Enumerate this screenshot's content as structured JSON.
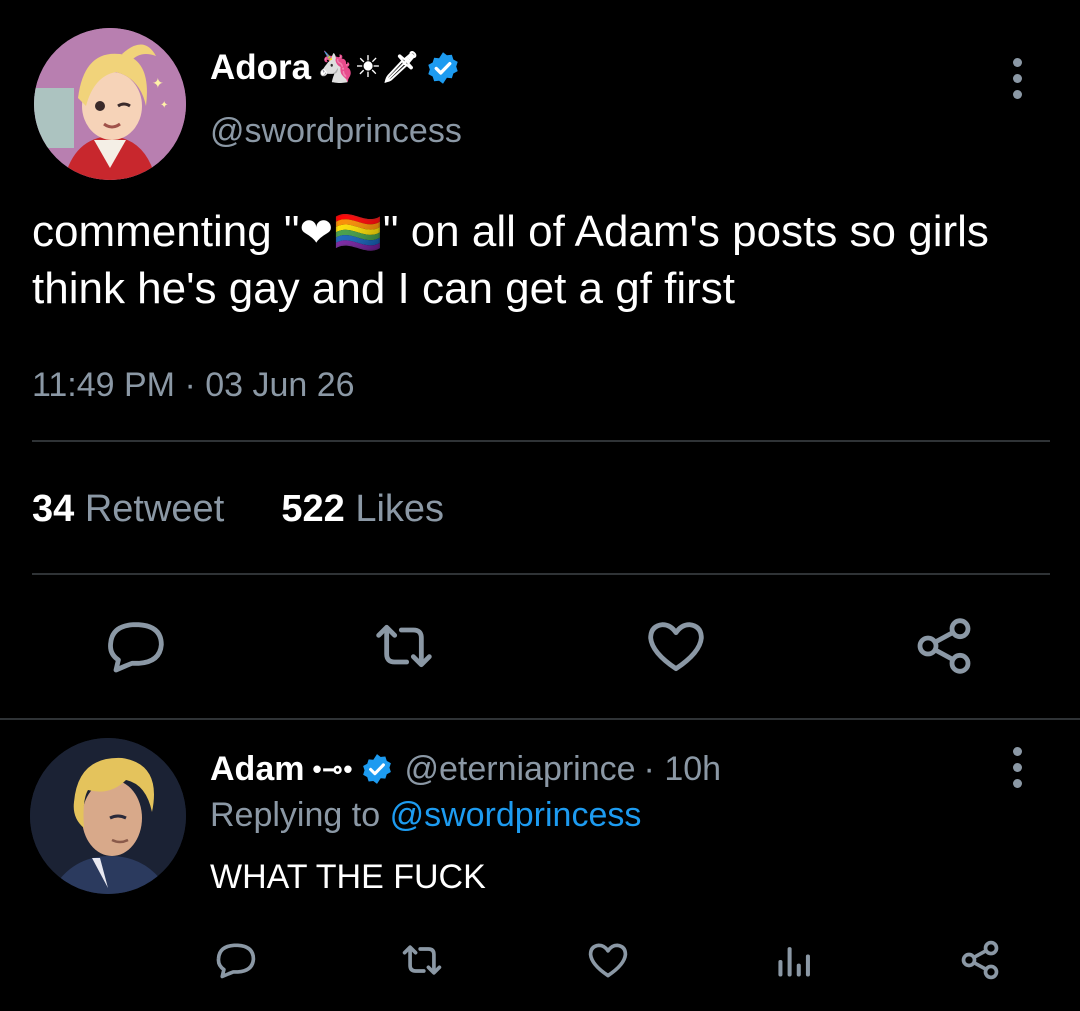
{
  "tweet": {
    "author": {
      "display_name": "Adora",
      "name_emojis": "🦄☀🗡",
      "handle": "@swordprincess",
      "verified": true
    },
    "text_before": "commenting \"",
    "text_emojis": "❤🏳️‍🌈",
    "text_after": "\" on all of Adam's posts so girls think he's gay and I can get a gf first",
    "timestamp": "11:49 PM · 03 Jun 26",
    "retweet_count": "34",
    "retweet_label": "Retweet",
    "like_count": "522",
    "like_label": "Likes"
  },
  "reply": {
    "author": {
      "display_name": "Adam",
      "name_deco": "•⊸•",
      "handle": "@eterniaprince",
      "verified": true
    },
    "time": "· 10h",
    "replying_prefix": "Replying to",
    "replying_to": "@swordprincess",
    "text": "WHAT THE FUCK"
  },
  "colors": {
    "background": "#000000",
    "text": "#ffffff",
    "muted": "#8b98a5",
    "accent": "#1d9bf0",
    "divider": "#2f3336"
  },
  "icons": [
    "verified-badge-icon",
    "more-icon",
    "reply-icon",
    "retweet-icon",
    "like-icon",
    "share-icon",
    "analytics-icon"
  ]
}
